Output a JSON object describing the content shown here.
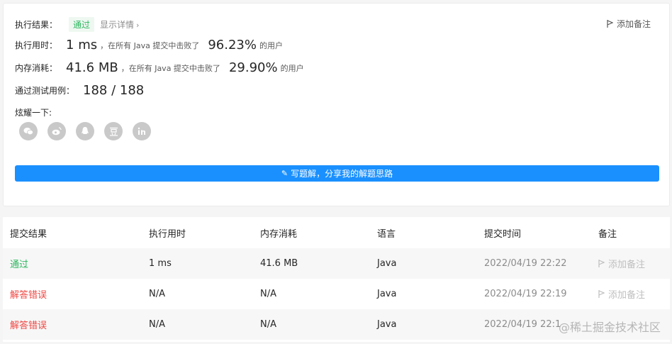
{
  "result": {
    "label": "执行结果：",
    "status": "通过",
    "detail_link": "显示详情",
    "add_note": "添加备注"
  },
  "runtime": {
    "label": "执行用时：",
    "value": "1 ms",
    "prefix": "，在所有 Java 提交中击败了",
    "percent": "96.23%",
    "suffix": "的用户"
  },
  "memory": {
    "label": "内存消耗：",
    "value": "41.6 MB",
    "prefix": "，在所有 Java 提交中击败了",
    "percent": "29.90%",
    "suffix": "的用户"
  },
  "tests": {
    "label": "通过测试用例：",
    "value": "188 / 188"
  },
  "share": {
    "label": "炫耀一下:",
    "icons": [
      "wechat-icon",
      "weibo-icon",
      "qq-icon",
      "douban-icon",
      "linkedin-icon"
    ]
  },
  "write_button": "写题解，分享我的解题思路",
  "table": {
    "headers": [
      "提交结果",
      "执行用时",
      "内存消耗",
      "语言",
      "提交时间",
      "备注"
    ],
    "rows": [
      {
        "result": "通过",
        "status": "ok",
        "time": "1 ms",
        "memory": "41.6 MB",
        "lang": "Java",
        "submitted": "2022/04/19 22:22",
        "note": "添加备注"
      },
      {
        "result": "解答错误",
        "status": "err",
        "time": "N/A",
        "memory": "N/A",
        "lang": "Java",
        "submitted": "2022/04/19 22:19",
        "note": "添加备注"
      },
      {
        "result": "解答错误",
        "status": "err",
        "time": "N/A",
        "memory": "N/A",
        "lang": "Java",
        "submitted": "2022/04/19 22:1",
        "note": ""
      }
    ]
  },
  "watermark": "@稀土掘金技术社区",
  "colors": {
    "accent": "#1a90ff",
    "success": "#2db55d",
    "error": "#ef4743"
  }
}
